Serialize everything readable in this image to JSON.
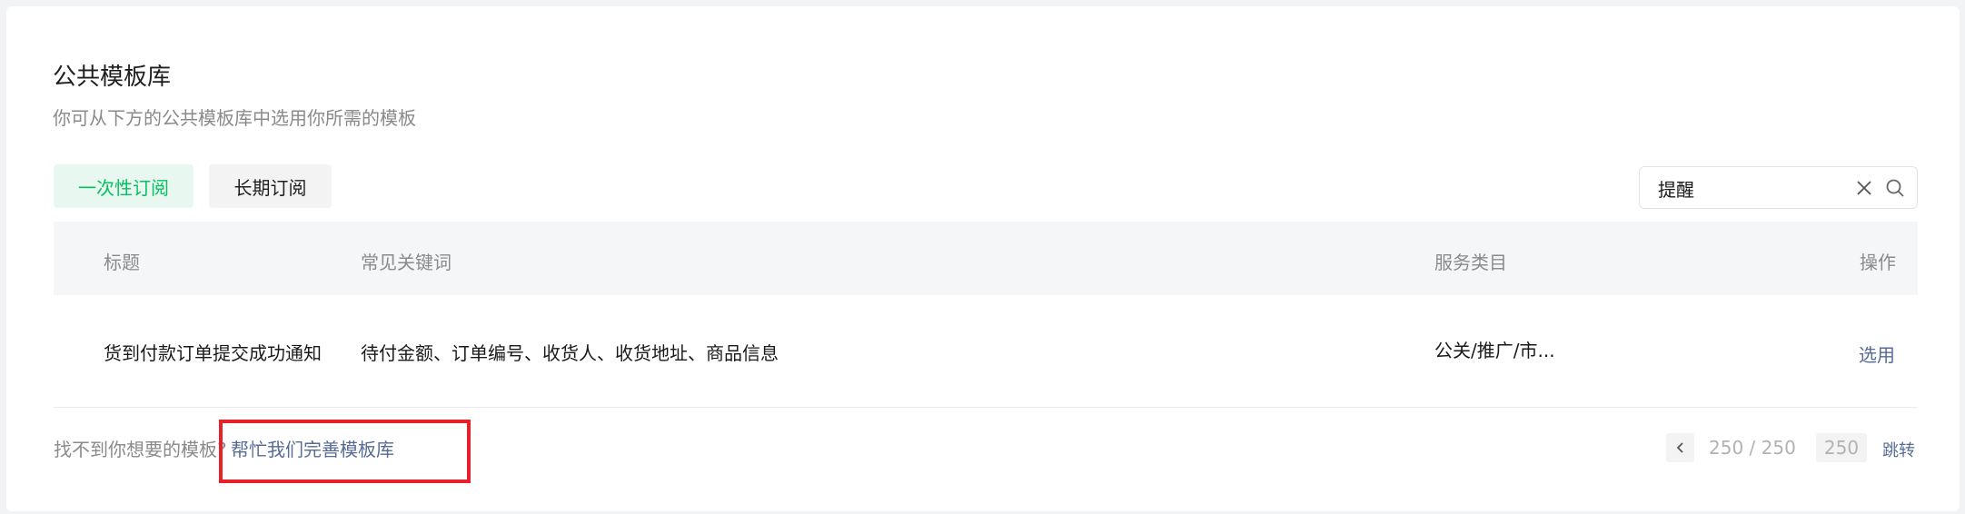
{
  "header": {
    "title": "公共模板库",
    "subtitle": "你可从下方的公共模板库中选用你所需的模板"
  },
  "tabs": [
    {
      "label": "一次性订阅",
      "active": true
    },
    {
      "label": "长期订阅",
      "active": false
    }
  ],
  "search": {
    "value": "提醒",
    "clear_icon": "close-icon",
    "search_icon": "search-icon"
  },
  "table": {
    "columns": [
      "标题",
      "常见关键词",
      "服务类目",
      "操作"
    ],
    "rows": [
      {
        "title": "货到付款订单提交成功通知",
        "keywords": "待付金额、订单编号、收货人、收货地址、商品信息",
        "category": "公关/推广/市...",
        "action": "选用"
      }
    ]
  },
  "footer": {
    "prompt": "找不到你想要的模板?",
    "help_link": "帮忙我们完善模板库"
  },
  "pagination": {
    "info": "250 / 250",
    "page_input": "250",
    "jump_label": "跳转"
  },
  "colors": {
    "accent_green": "#07c160",
    "link_blue": "#576b95",
    "highlight_red": "#e8202a"
  }
}
